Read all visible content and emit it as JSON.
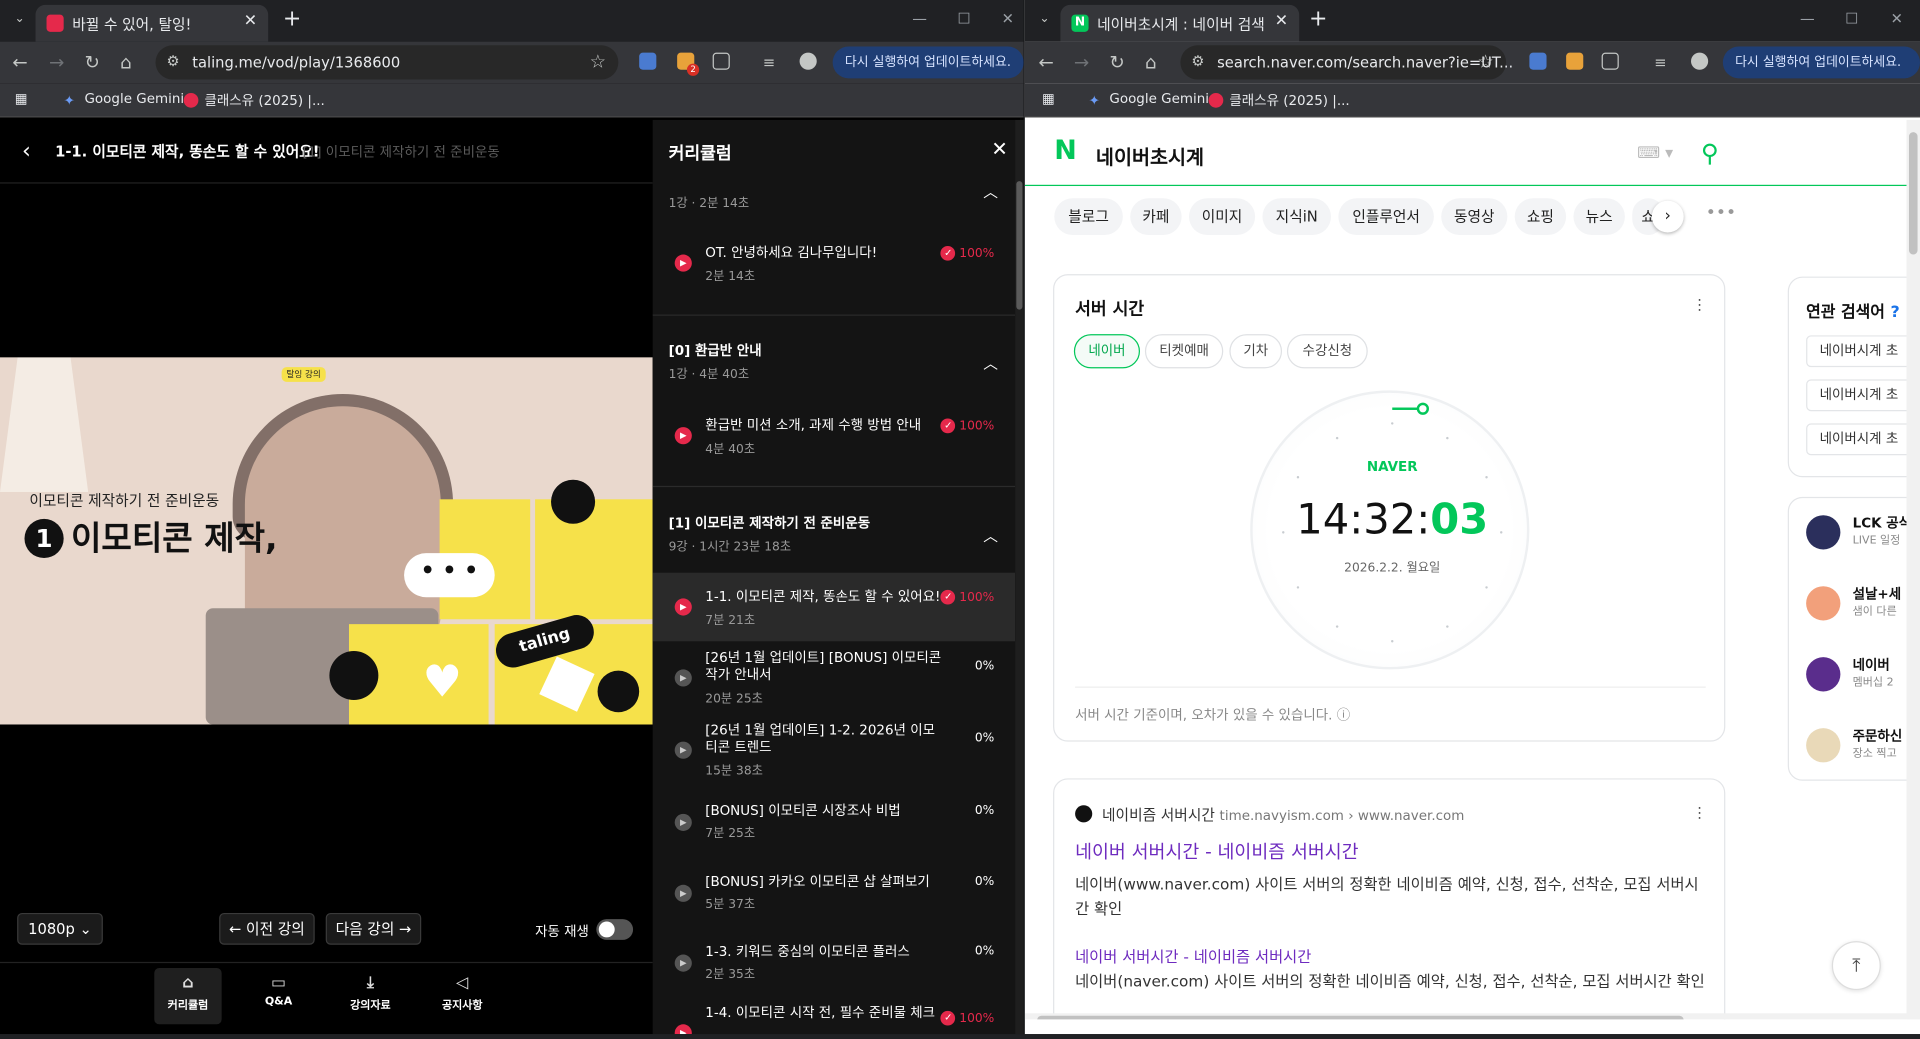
{
  "left_window": {
    "tab_title": "바뀔 수 있어, 탈잉!",
    "url": "taling.me/vod/play/1368600",
    "update_label": "다시 실행하여 업데이트하세요.",
    "bookmarks": [
      "Google Gemini",
      "클래스유 (2025) |..."
    ],
    "ext_badge": "2"
  },
  "player": {
    "lesson_title": "1-1. 이모티콘 제작, 똥손도 할 수 있어요!",
    "section_subtitle": "[1] 이모티콘 제작하기 전 준비운동",
    "video": {
      "caption_small": "이모티콘 제작하기 전 준비운동",
      "caption_number": "1",
      "caption_big": "이모티콘 제작,",
      "sticker_text": "taling",
      "bubble_text": "• • •",
      "logo_text": "탈잉 강의"
    },
    "quality": "1080p",
    "prev_label": "이전 강의",
    "next_label": "다음 강의",
    "autoplay_label": "자동 재생",
    "autoplay_on": false,
    "bottom_nav": [
      {
        "label": "커리큘럼",
        "icon": "graduation-icon"
      },
      {
        "label": "Q&A",
        "icon": "chat-icon"
      },
      {
        "label": "강의자료",
        "icon": "download-icon"
      },
      {
        "label": "공지사항",
        "icon": "megaphone-icon"
      }
    ]
  },
  "curriculum": {
    "header": "커리큘럼",
    "sections": [
      {
        "title": "",
        "meta": "1강 · 2분 14초",
        "lessons": [
          {
            "title": "OT. 안녕하세요 김나무입니다!",
            "duration": "2분 14초",
            "progress": "100%"
          }
        ]
      },
      {
        "title": "[0] 환급반 안내",
        "meta": "1강 · 4분 40초",
        "lessons": [
          {
            "title": "환급반 미션 소개, 과제 수행 방법 안내",
            "duration": "4분 40초",
            "progress": "100%"
          }
        ]
      },
      {
        "title": "[1] 이모티콘 제작하기 전 준비운동",
        "meta": "9강 · 1시간 23분 18초",
        "lessons": [
          {
            "title": "1-1. 이모티콘 제작, 똥손도 할 수 있어요!",
            "duration": "7분 21초",
            "progress": "100%"
          },
          {
            "title": "[26년 1월 업데이트] [BONUS] 이모티콘 작가 안내서",
            "duration": "20분 25초",
            "progress": "0%"
          },
          {
            "title": "[26년 1월 업데이트] 1-2. 2026년 이모티콘 트렌드",
            "duration": "15분 38초",
            "progress": "0%"
          },
          {
            "title": "[BONUS] 이모티콘 시장조사 비법",
            "duration": "7분 25초",
            "progress": "0%"
          },
          {
            "title": "[BONUS] 카카오 이모티콘 샵 살펴보기",
            "duration": "5분 37초",
            "progress": "0%"
          },
          {
            "title": "1-3. 키워드 중심의 이모티콘 플러스",
            "duration": "2분 35초",
            "progress": "0%"
          },
          {
            "title": "1-4. 이모티콘 시작 전, 필수 준비물 체크",
            "duration": "",
            "progress": "100%"
          }
        ]
      }
    ]
  },
  "right_window": {
    "tab_title": "네이버초시계 : 네이버 검색",
    "url": "search.naver.com/search.naver?ie=UT...",
    "update_label": "다시 실행하여 업데이트하세요.",
    "bookmarks": [
      "Google Gemini",
      "클래스유 (2025) |..."
    ]
  },
  "naver": {
    "query": "네이버초시계",
    "chips": [
      "블로그",
      "카페",
      "이미지",
      "지식iN",
      "인플루언서",
      "동영상",
      "쇼핑",
      "뉴스",
      "쇼"
    ],
    "server_card": {
      "title": "서버 시간",
      "tabs": [
        "네이버",
        "티켓예매",
        "기차",
        "수강신청"
      ],
      "brand": "NAVER",
      "time_hm": "14:32:",
      "time_s": "03",
      "date": "2026.2.2. 월요일",
      "note": "서버 시간 기준이며, 오차가 있을 수 있습니다."
    },
    "result": {
      "site_name": "네이비즘 서버시간",
      "site_url": "time.navyism.com › www.naver.com",
      "title": "네이버 서버시간 - 네이비즘 서버시간",
      "desc": "네이버(www.naver.com) 사이트 서버의 정확한 네이비즘 예약, 신청, 접수, 선착순, 모집 서버시간 확인",
      "sub_title": "네이버 서버시간 - 네이비즘 서버시간",
      "sub_desc": "네이버(naver.com) 사이트 서버의 정확한 네이비즘 예약, 신청, 접수, 선착순, 모집 서버시간 확인"
    },
    "related": {
      "title": "연관 검색어",
      "items": [
        "네이버시계 초",
        "네이버시계 초",
        "네이버시계 초"
      ]
    },
    "feed": [
      {
        "name": "LCK 공식",
        "sub": "LIVE 일정",
        "color": "#2b2f5c"
      },
      {
        "name": "설날+세",
        "sub": "샘이 다른",
        "color": "#f2a07b"
      },
      {
        "name": "네이버",
        "sub": "멤버십 2",
        "color": "#5a2d8c"
      },
      {
        "name": "주문하신",
        "sub": "장소 찍고",
        "color": "#e9d9b8"
      }
    ]
  }
}
